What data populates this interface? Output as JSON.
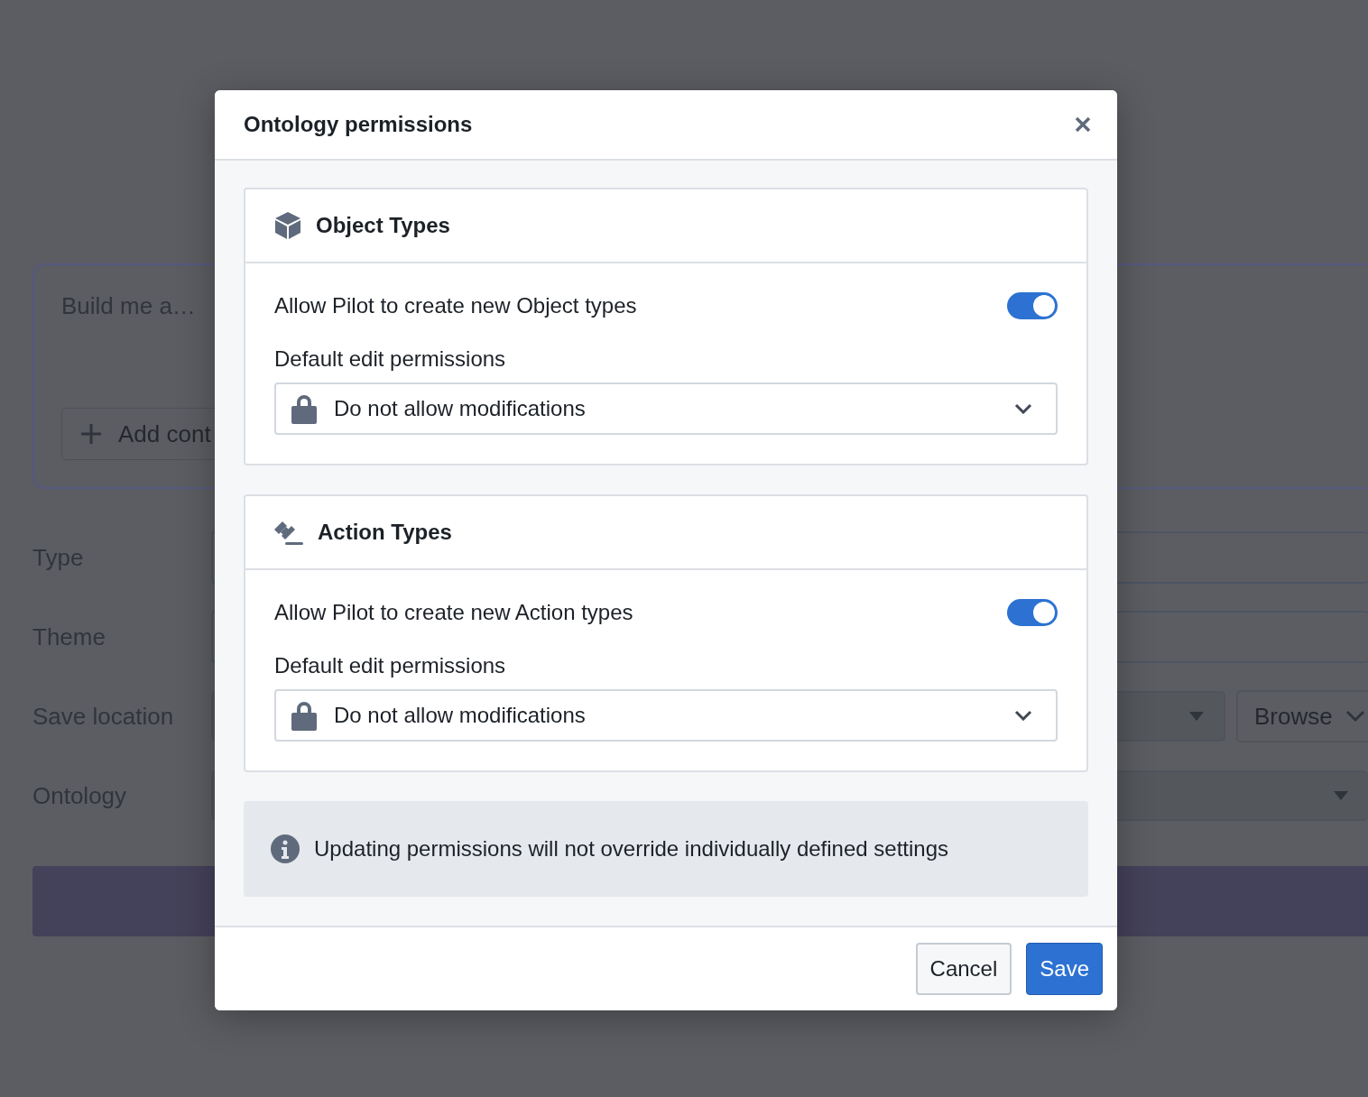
{
  "background_form": {
    "prompt": {
      "placeholder": "Build me a…",
      "add_button": "Add cont"
    },
    "fields": [
      {
        "label": "Type",
        "kind": "input"
      },
      {
        "label": "Theme",
        "kind": "input"
      },
      {
        "label": "Save location",
        "kind": "select",
        "button": "Browse"
      },
      {
        "label": "Ontology",
        "kind": "select"
      }
    ]
  },
  "dialog": {
    "title": "Ontology permissions",
    "sections": [
      {
        "kind": "object",
        "title": "Object Types",
        "toggle_label": "Allow Pilot to create new Object types",
        "toggle_on": true,
        "permissions_label": "Default edit permissions",
        "permissions_value": "Do not allow modifications"
      },
      {
        "kind": "action",
        "title": "Action Types",
        "toggle_label": "Allow Pilot to create new Action types",
        "toggle_on": true,
        "permissions_label": "Default edit permissions",
        "permissions_value": "Do not allow modifications"
      }
    ],
    "info": "Updating permissions will not override individually defined settings",
    "buttons": [
      {
        "label": "Cancel",
        "kind": "secondary"
      },
      {
        "label": "Save",
        "kind": "primary"
      }
    ]
  }
}
